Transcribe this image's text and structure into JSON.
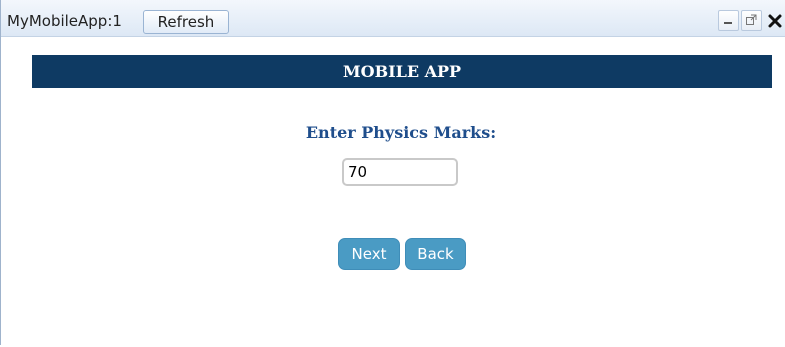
{
  "window": {
    "app_title": "MyMobileApp:1",
    "refresh_label": "Refresh",
    "controls": [
      "minimize-icon",
      "popout-icon",
      "close-icon"
    ]
  },
  "app": {
    "header_title": "MOBILE APP",
    "prompt_label": "Enter Physics Marks:",
    "marks_value": "70",
    "next_label": "Next",
    "back_label": "Back"
  },
  "colors": {
    "header_bg": "#0e3a63",
    "prompt_text": "#1f4e8c",
    "button_bg": "#4a9bc4"
  }
}
